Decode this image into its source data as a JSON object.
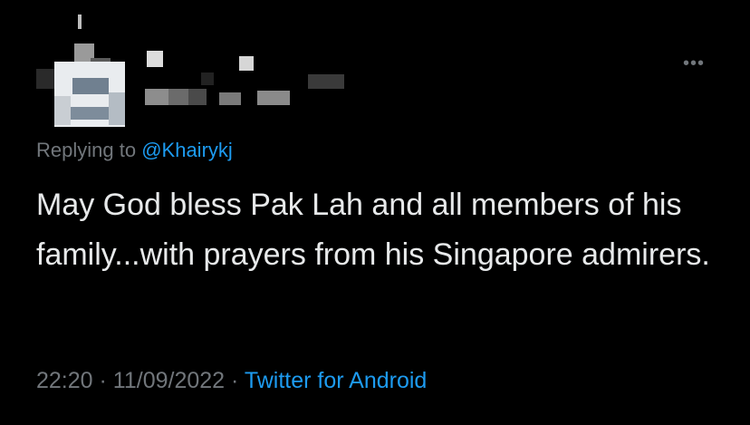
{
  "tweet": {
    "reply_prefix": "Replying to",
    "reply_handle": "@Khairykj",
    "text": "May God bless Pak Lah and all members of his family...with prayers from his Singapore admirers.",
    "time": "22:20",
    "separator": "·",
    "date": "11/09/2022",
    "source": "Twitter for Android",
    "more_icon": "more-horizontal-icon"
  },
  "colors": {
    "background": "#000000",
    "text": "#e7e9ea",
    "secondary": "#71767b",
    "link": "#1d9bf0"
  }
}
